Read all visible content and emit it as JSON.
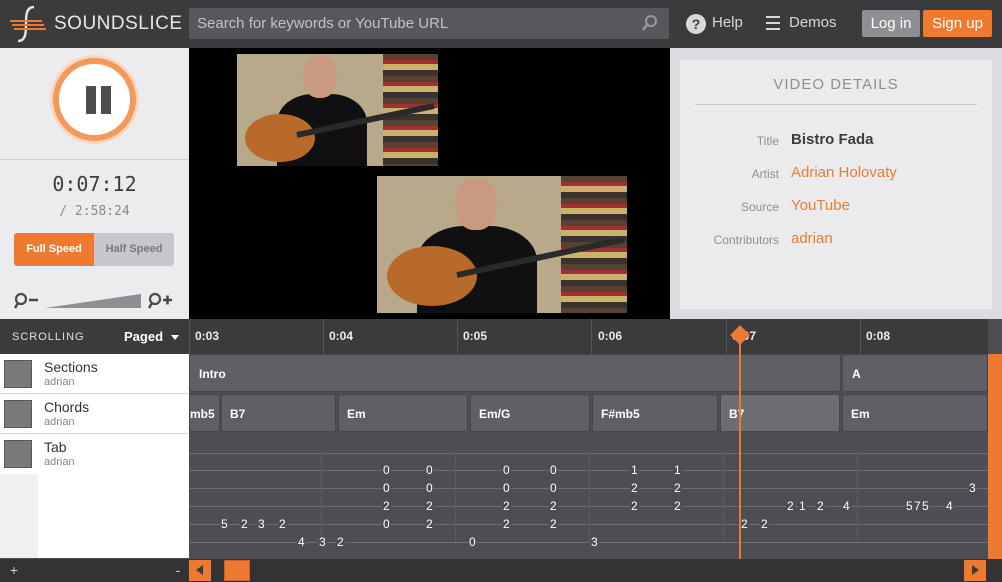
{
  "header": {
    "brand": "SOUNDSLICE",
    "search_placeholder": "Search for keywords or YouTube URL",
    "help_label": "Help",
    "demos_label": "Demos",
    "login_label": "Log in",
    "signup_label": "Sign up",
    "accent_color": "#ee7a32"
  },
  "player": {
    "state": "playing",
    "current_time": "0:07:12",
    "total_time": "/ 2:58:24",
    "speed_full_label": "Full Speed",
    "speed_half_label": "Half Speed",
    "selected_speed": "Full Speed",
    "zoom_out_icon": "zoom-out-icon",
    "zoom_in_icon": "zoom-in-icon"
  },
  "video_details": {
    "heading": "VIDEO DETAILS",
    "fields": [
      {
        "label": "Title",
        "value": "Bistro Fada"
      },
      {
        "label": "Artist",
        "value": "Adrian Holovaty"
      },
      {
        "label": "Source",
        "value": "YouTube"
      },
      {
        "label": "Contributors",
        "value": "adrian"
      }
    ]
  },
  "timeline": {
    "scrolling_label": "SCROLLING",
    "paged_label": "Paged",
    "ticks": [
      "0:03",
      "0:04",
      "0:05",
      "0:06",
      "0:07",
      "0:08"
    ],
    "tracks": [
      {
        "name": "Sections",
        "user": "adrian"
      },
      {
        "name": "Chords",
        "user": "adrian"
      },
      {
        "name": "Tab",
        "user": "adrian"
      }
    ],
    "sections": [
      "Intro",
      "A"
    ],
    "chords": [
      "mb5",
      "B7",
      "Em",
      "Em/G",
      "F#mb5",
      "B7",
      "Em"
    ],
    "tab_notes": [
      "0",
      "0",
      "0",
      "0",
      "1",
      "1",
      "0",
      "0",
      "0",
      "0",
      "2",
      "2",
      "3",
      "2",
      "2",
      "2",
      "2",
      "2",
      "2",
      "2",
      "1",
      "2",
      "4",
      "5",
      "7",
      "5",
      "4",
      "5",
      "2",
      "3",
      "2",
      "0",
      "2",
      "2",
      "2",
      "2",
      "2",
      "4",
      "3",
      "2",
      "0",
      "3",
      "2"
    ],
    "add_label": "+",
    "remove_label": "-"
  }
}
